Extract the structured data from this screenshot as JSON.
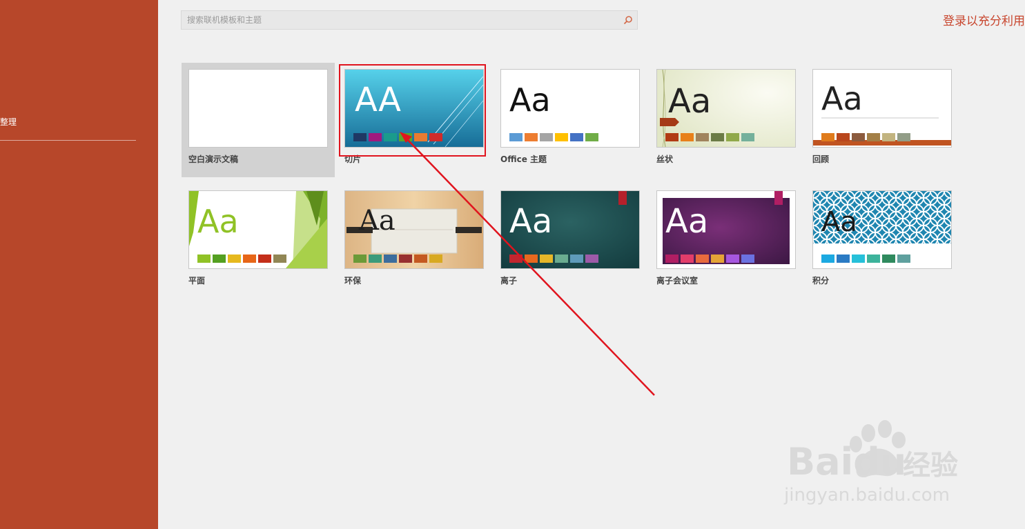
{
  "sidebar": {
    "item_label": "整理"
  },
  "search": {
    "placeholder": "搜索联机模板和主题"
  },
  "header": {
    "signin_text": "登录以充分利用"
  },
  "templates": [
    {
      "label": "空白演示文稿",
      "selected": true
    },
    {
      "label": "切片",
      "preview_text": "Aa",
      "swatches": [
        "#1f3864",
        "#a0197e",
        "#1a9b8c",
        "#5aa52d",
        "#e97b30",
        "#d12b2b"
      ]
    },
    {
      "label": "Office 主题",
      "preview_text": "Aa",
      "swatches": [
        "#5b9bd5",
        "#ed7d31",
        "#a5a5a5",
        "#ffc000",
        "#4472c4",
        "#70ad47"
      ]
    },
    {
      "label": "丝状",
      "preview_text": "Aa",
      "swatches": [
        "#b13b13",
        "#e8801a",
        "#a0835c",
        "#6b7b46",
        "#90a94a",
        "#74b09b"
      ]
    },
    {
      "label": "回顾",
      "preview_text": "Aa",
      "swatches": [
        "#e07b1c",
        "#b9471d",
        "#8c5b3e",
        "#a37f47",
        "#c2b480",
        "#929d87"
      ]
    },
    {
      "label": "平面",
      "preview_text": "Aa",
      "swatches": [
        "#90c226",
        "#54a021",
        "#e6b91e",
        "#e76618",
        "#c42f1a",
        "#918655"
      ]
    },
    {
      "label": "环保",
      "preview_text": "Aa",
      "swatches": [
        "#6b9a38",
        "#3b9b7b",
        "#3c6d9d",
        "#983030",
        "#c45921",
        "#d8a921"
      ]
    },
    {
      "label": "离子",
      "preview_text": "Aa",
      "swatches": [
        "#c1262f",
        "#e8681f",
        "#e6b729",
        "#6aac90",
        "#5f9bba",
        "#9d5aa8"
      ]
    },
    {
      "label": "离子会议室",
      "preview_text": "Aa",
      "swatches": [
        "#b01e63",
        "#e33d6a",
        "#e86a3d",
        "#e5a437",
        "#a657e0",
        "#6b71e0"
      ]
    },
    {
      "label": "积分",
      "preview_text": "Aa",
      "swatches": [
        "#1ca9e1",
        "#2b7bc4",
        "#26c0d9",
        "#3db39b",
        "#2f8a5e",
        "#5fa09e"
      ]
    }
  ],
  "watermark": {
    "brand": "Baidu",
    "brand_suffix": "经验",
    "url": "jingyan.baidu.com"
  },
  "colors": {
    "sidebar": "#b7472a",
    "highlight": "#e0141e",
    "signin": "#c8452d"
  }
}
